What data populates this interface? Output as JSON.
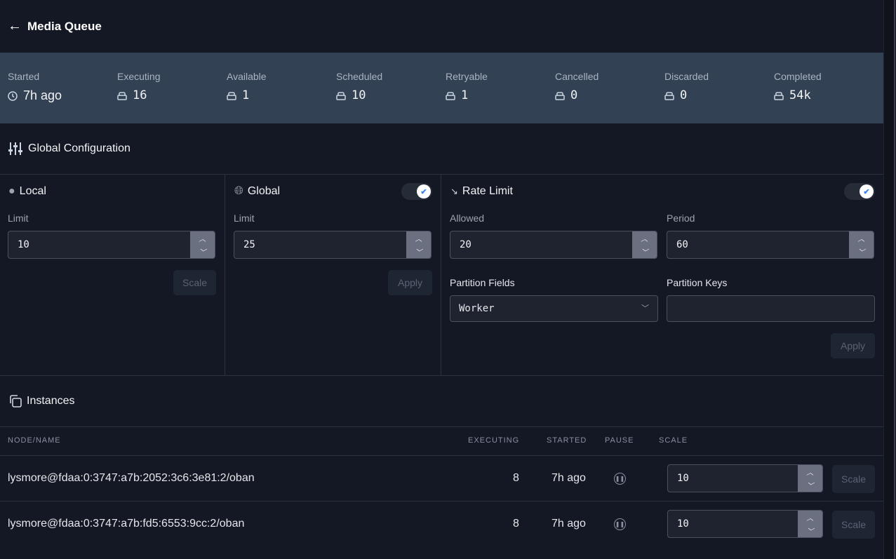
{
  "header": {
    "title": "Media Queue",
    "back_icon": "arrow-left-icon"
  },
  "stats": [
    {
      "label": "Started",
      "value": "7h ago",
      "icon": "clock-icon"
    },
    {
      "label": "Executing",
      "value": "16",
      "icon": "stack-icon"
    },
    {
      "label": "Available",
      "value": "1",
      "icon": "stack-icon"
    },
    {
      "label": "Scheduled",
      "value": "10",
      "icon": "stack-icon"
    },
    {
      "label": "Retryable",
      "value": "1",
      "icon": "stack-icon"
    },
    {
      "label": "Cancelled",
      "value": "0",
      "icon": "stack-icon"
    },
    {
      "label": "Discarded",
      "value": "0",
      "icon": "stack-icon"
    },
    {
      "label": "Completed",
      "value": "54k",
      "icon": "stack-icon"
    }
  ],
  "config": {
    "title": "Global Configuration",
    "local": {
      "title": "Local",
      "limit_label": "Limit",
      "limit": "10",
      "button": "Scale"
    },
    "global": {
      "title": "Global",
      "limit_label": "Limit",
      "limit": "25",
      "button": "Apply",
      "enabled": true
    },
    "rate": {
      "title": "Rate Limit",
      "enabled": true,
      "allowed_label": "Allowed",
      "allowed": "20",
      "period_label": "Period",
      "period": "60",
      "fields_label": "Partition Fields",
      "fields": "Worker",
      "keys_label": "Partition Keys",
      "keys": "",
      "button": "Apply"
    }
  },
  "instances": {
    "title": "Instances",
    "columns": [
      "NODE/NAME",
      "EXECUTING",
      "STARTED",
      "PAUSE",
      "SCALE"
    ],
    "rows": [
      {
        "name": "lysmore@fdaa:0:3747:a7b:2052:3c6:3e81:2/oban",
        "executing": "8",
        "started": "7h ago",
        "scale": "10",
        "button": "Scale"
      },
      {
        "name": "lysmore@fdaa:0:3747:a7b:fd5:6553:9cc:2/oban",
        "executing": "8",
        "started": "7h ago",
        "scale": "10",
        "button": "Scale"
      }
    ]
  }
}
